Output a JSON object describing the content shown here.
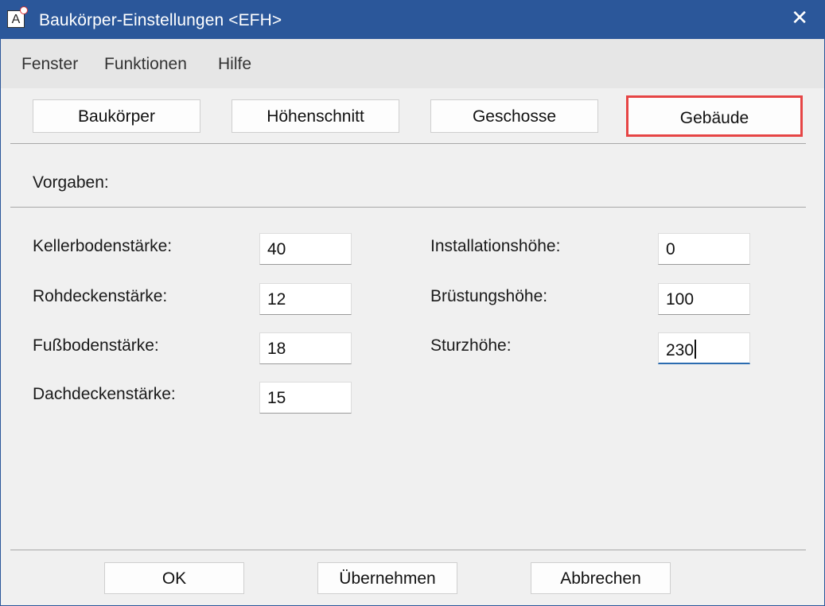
{
  "window": {
    "title": "Baukörper-Einstellungen <EFH>",
    "app_icon_letter": "A",
    "close_glyph": "✕"
  },
  "menu": {
    "items": [
      "Fenster",
      "Funktionen",
      "Hilfe"
    ]
  },
  "tabs": {
    "items": [
      "Baukörper",
      "Höhenschnitt",
      "Geschosse",
      "Gebäude"
    ],
    "active": "Gebäude",
    "active_outline_color": "#e64545"
  },
  "section": {
    "title": "Vorgaben:"
  },
  "fields": {
    "left": [
      {
        "label": "Kellerbodenstärke:",
        "value": "40"
      },
      {
        "label": "Rohdeckenstärke:",
        "value": "12"
      },
      {
        "label": "Fußbodenstärke:",
        "value": "18"
      },
      {
        "label": "Dachdeckenstärke:",
        "value": "15"
      }
    ],
    "right": [
      {
        "label": "Installationshöhe:",
        "value": "0"
      },
      {
        "label": "Brüstungshöhe:",
        "value": "100"
      },
      {
        "label": "Sturzhöhe:",
        "value": "230"
      }
    ]
  },
  "footer": {
    "ok": "OK",
    "apply": "Übernehmen",
    "cancel": "Abbrechen"
  },
  "colors": {
    "titlebar": "#2b579a",
    "focus_underline": "#2b6cb0"
  }
}
